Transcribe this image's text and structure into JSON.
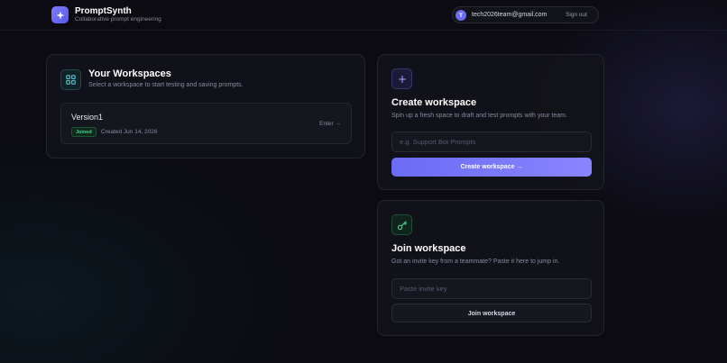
{
  "brand": {
    "name": "PromptSynth",
    "tagline": "Collaborative prompt engineering",
    "logo_icon": "sparkle-icon"
  },
  "user": {
    "avatar_initial": "T",
    "email": "tech2026team@gmail.com",
    "signout_label": "Sign out"
  },
  "workspaces": {
    "title": "Your Workspaces",
    "subtitle": "Select a workspace to start testing and saving prompts.",
    "icon": "grid-icon",
    "items": [
      {
        "name": "Version1",
        "badge": "Joined",
        "created": "Created Jun 14, 2026",
        "enter_label": "Enter →"
      }
    ]
  },
  "create": {
    "icon": "plus-icon",
    "title": "Create workspace",
    "subtitle": "Spin up a fresh space to draft and test prompts with your team.",
    "input_placeholder": "e.g. Support Bot Prompts",
    "button_label": "Create workspace →"
  },
  "join": {
    "icon": "key-icon",
    "title": "Join workspace",
    "subtitle": "Got an invite key from a teammate? Paste it here to jump in.",
    "input_placeholder": "Paste invite key",
    "button_label": "Join workspace"
  },
  "colors": {
    "accent": "#6a6cf5",
    "success": "#46d38a",
    "background": "#0b0b11",
    "card": "#12121a"
  }
}
